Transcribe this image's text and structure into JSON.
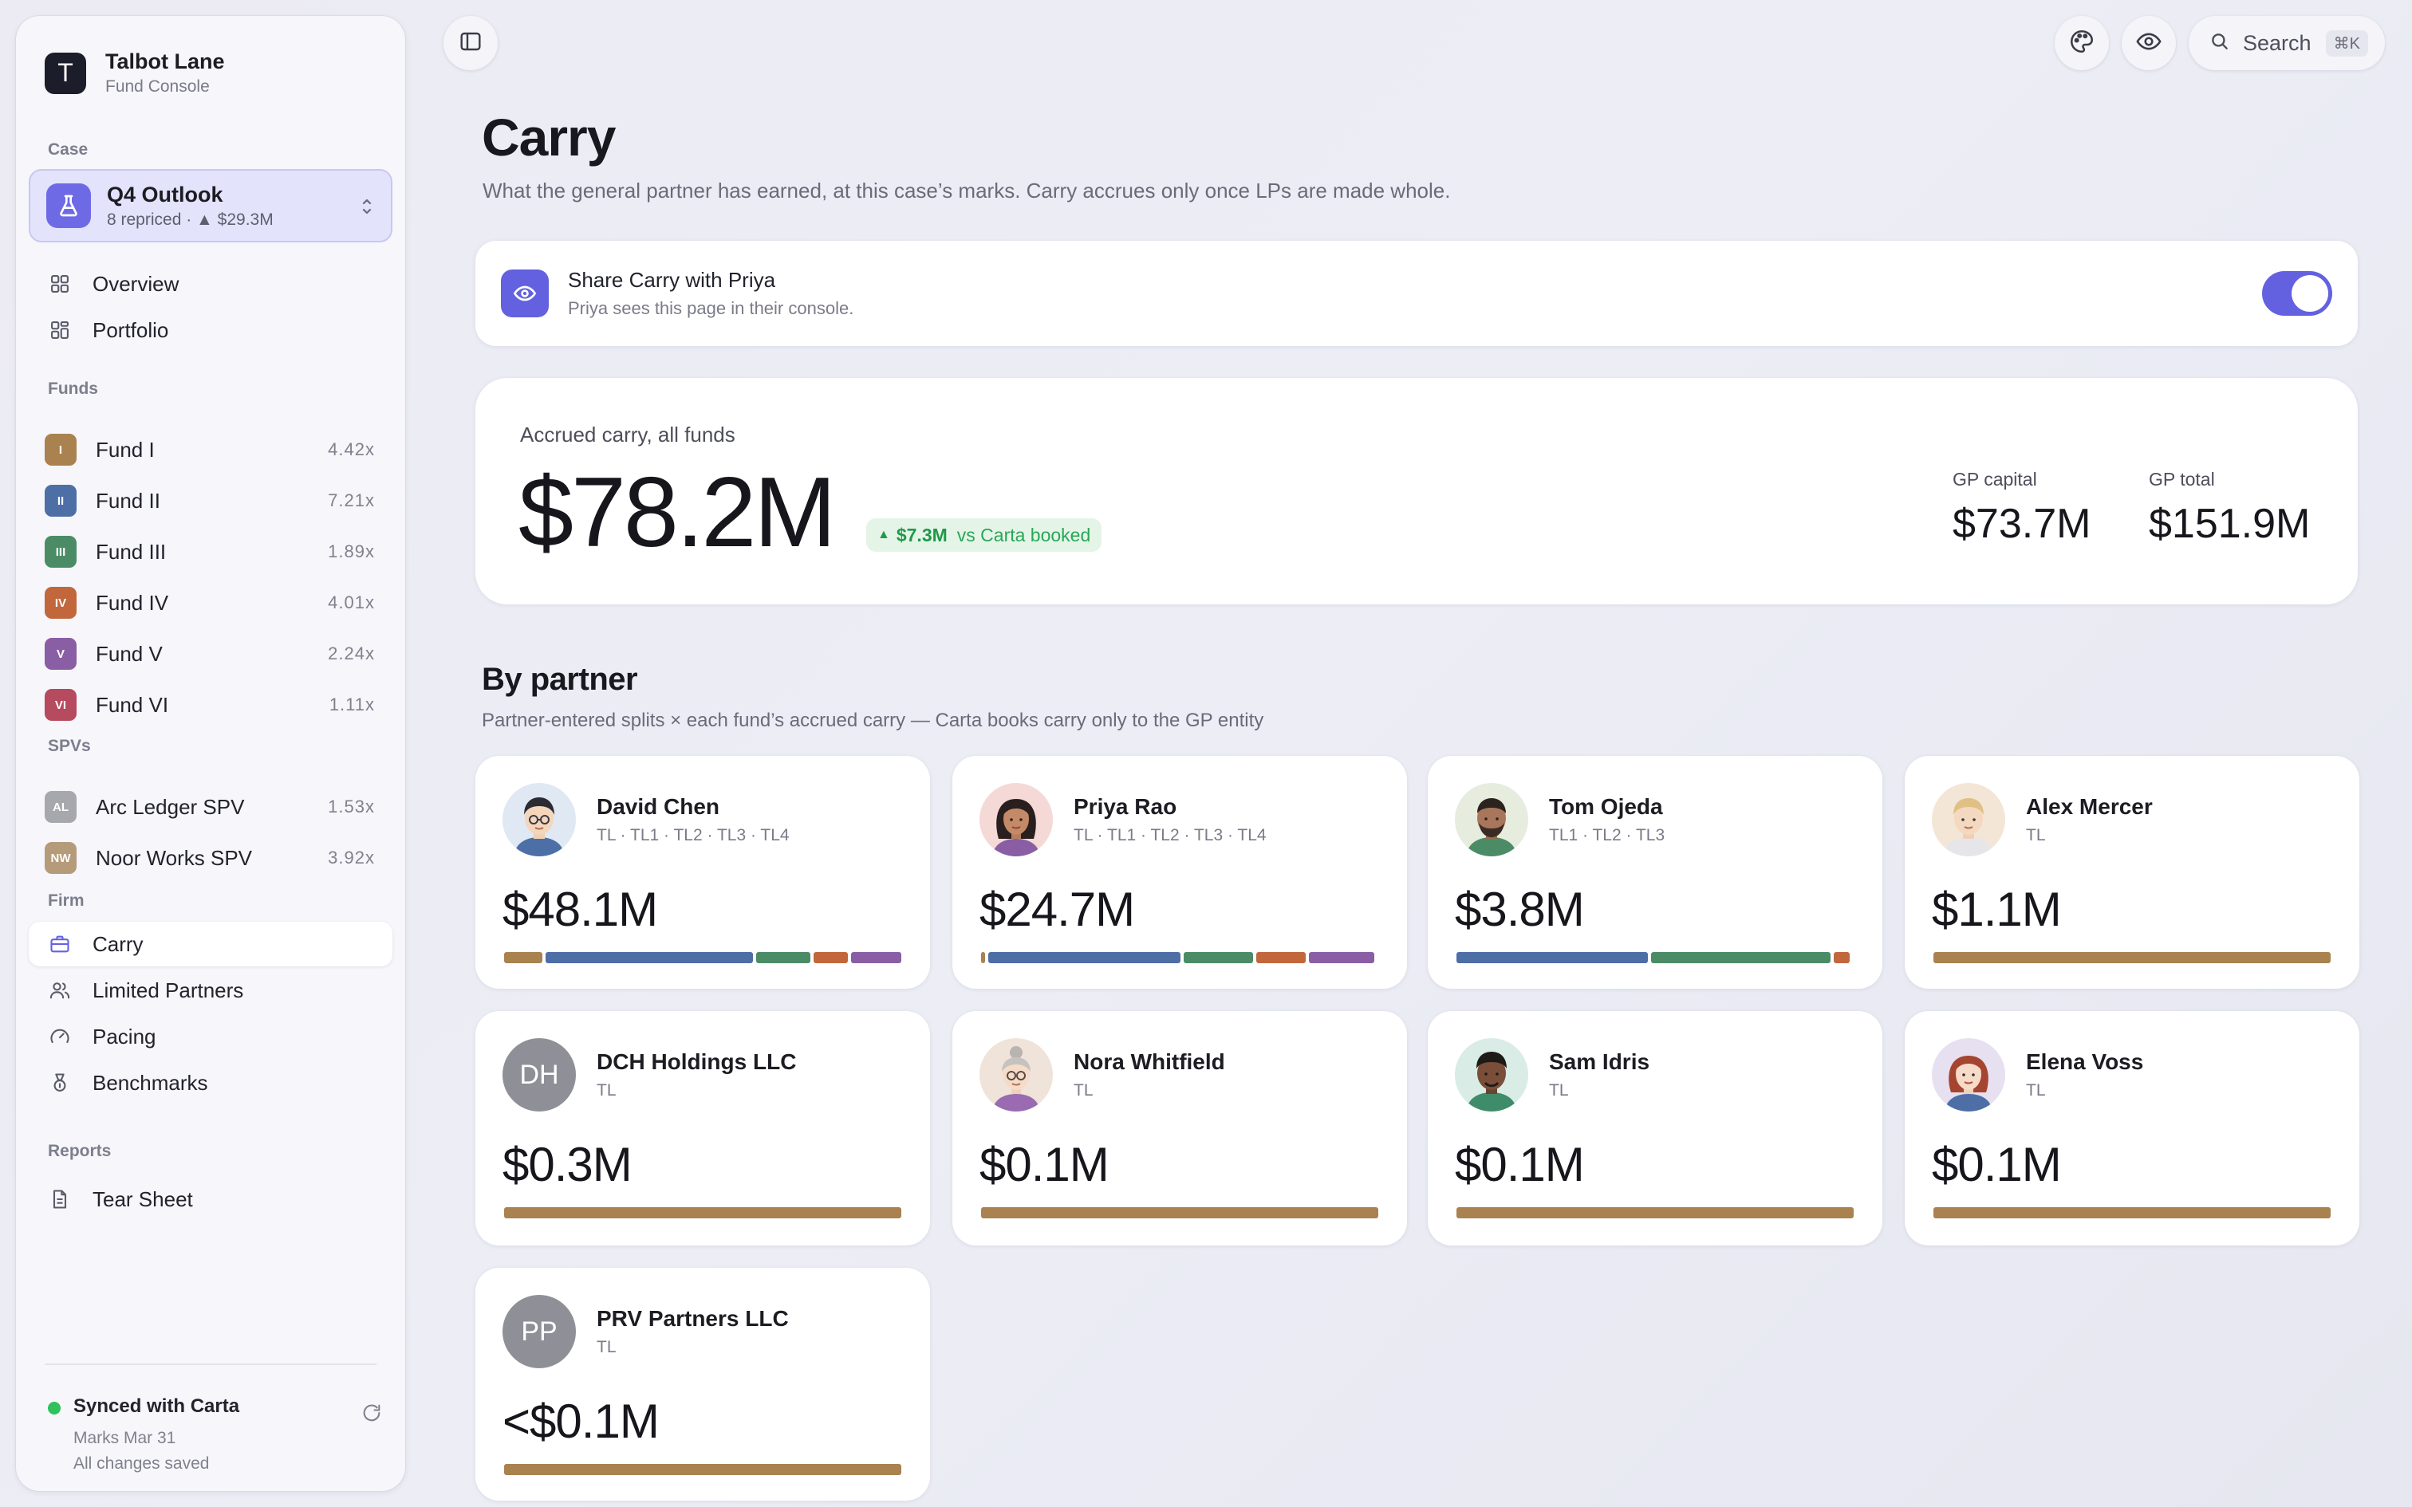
{
  "brand": {
    "initial": "T",
    "name": "Talbot Lane",
    "subtitle": "Fund Console"
  },
  "sidebar": {
    "case_label": "Case",
    "case": {
      "title": "Q4 Outlook",
      "subtitle": "8 repriced · ▲ $29.3M"
    },
    "nav": [
      {
        "label": "Overview",
        "icon": "grid-icon"
      },
      {
        "label": "Portfolio",
        "icon": "portfolio-icon"
      }
    ],
    "funds_label": "Funds",
    "funds": [
      {
        "badge": "I",
        "label": "Fund I",
        "value": "4.42x",
        "color": "#a9824f"
      },
      {
        "badge": "II",
        "label": "Fund II",
        "value": "7.21x",
        "color": "#4e6ea6"
      },
      {
        "badge": "III",
        "label": "Fund III",
        "value": "1.89x",
        "color": "#4b8c67"
      },
      {
        "badge": "IV",
        "label": "Fund IV",
        "value": "4.01x",
        "color": "#c2673c"
      },
      {
        "badge": "V",
        "label": "Fund V",
        "value": "2.24x",
        "color": "#8a5ea4"
      },
      {
        "badge": "VI",
        "label": "Fund VI",
        "value": "1.11x",
        "color": "#b64a5e"
      }
    ],
    "spvs_label": "SPVs",
    "spvs": [
      {
        "badge": "AL",
        "label": "Arc Ledger SPV",
        "value": "1.53x",
        "color": "#a7a7ae"
      },
      {
        "badge": "NW",
        "label": "Noor Works SPV",
        "value": "3.92x",
        "color": "#b69b7b"
      }
    ],
    "firm_label": "Firm",
    "firm": [
      {
        "label": "Carry",
        "icon": "briefcase-icon",
        "active": true
      },
      {
        "label": "Limited Partners",
        "icon": "users-icon"
      },
      {
        "label": "Pacing",
        "icon": "gauge-icon"
      },
      {
        "label": "Benchmarks",
        "icon": "medal-icon"
      }
    ],
    "reports_label": "Reports",
    "reports": [
      {
        "label": "Tear Sheet",
        "icon": "document-icon"
      }
    ],
    "sync": {
      "title": "Synced with Carta",
      "line1": "Marks Mar 31",
      "line2": "All changes saved"
    }
  },
  "topbar": {
    "search_label": "Search",
    "shortcut": "⌘K"
  },
  "page": {
    "title": "Carry",
    "subtitle": "What the general partner has earned, at this case’s marks. Carry accrues only once LPs are made whole."
  },
  "share": {
    "title": "Share Carry with Priya",
    "subtitle": "Priya sees this page in their console.",
    "enabled": true
  },
  "accrued": {
    "label": "Accrued carry, all funds",
    "value": "$78.2M",
    "delta": "$7.3M",
    "delta_suffix": "vs Carta booked",
    "gp_capital_label": "GP capital",
    "gp_capital": "$73.7M",
    "gp_total_label": "GP total",
    "gp_total": "$151.9M"
  },
  "partners_section": {
    "title": "By partner",
    "subtitle": "Partner-entered splits × each fund’s accrued carry — Carta books carry only to the GP entity"
  },
  "fund_colors": {
    "TL": "#a9824f",
    "TL1": "#4e6ea6",
    "TL2": "#4b8c67",
    "TL3": "#c2673c",
    "TL4": "#8a5ea4"
  },
  "partners": [
    {
      "name": "David Chen",
      "tags": "TL · TL1 · TL2 · TL3 · TL4",
      "value": "$48.1M",
      "avatar": "avatar-david-chen",
      "split": [
        {
          "fund": "TL",
          "share": 0.1
        },
        {
          "fund": "TL1",
          "share": 0.54
        },
        {
          "fund": "TL2",
          "share": 0.14
        },
        {
          "fund": "TL3",
          "share": 0.09
        },
        {
          "fund": "TL4",
          "share": 0.13
        }
      ]
    },
    {
      "name": "Priya Rao",
      "tags": "TL · TL1 · TL2 · TL3 · TL4",
      "value": "$24.7M",
      "avatar": "avatar-priya-rao",
      "split": [
        {
          "fund": "TL",
          "share": 0.01
        },
        {
          "fund": "TL1",
          "share": 0.5
        },
        {
          "fund": "TL2",
          "share": 0.18
        },
        {
          "fund": "TL3",
          "share": 0.13
        },
        {
          "fund": "TL4",
          "share": 0.17
        }
      ]
    },
    {
      "name": "Tom Ojeda",
      "tags": "TL1 · TL2 · TL3",
      "value": "$3.8M",
      "avatar": "avatar-tom-ojeda",
      "split": [
        {
          "fund": "TL1",
          "share": 0.49
        },
        {
          "fund": "TL2",
          "share": 0.46
        },
        {
          "fund": "TL3",
          "share": 0.04
        }
      ]
    },
    {
      "name": "Alex Mercer",
      "tags": "TL",
      "value": "$1.1M",
      "avatar": "avatar-alex-mercer",
      "split": [
        {
          "fund": "TL",
          "share": 1
        }
      ]
    },
    {
      "name": "DCH Holdings LLC",
      "tags": "TL",
      "value": "$0.3M",
      "initials": "DH",
      "split": [
        {
          "fund": "TL",
          "share": 1
        }
      ]
    },
    {
      "name": "Nora Whitfield",
      "tags": "TL",
      "value": "$0.1M",
      "avatar": "avatar-nora-whitfield",
      "split": [
        {
          "fund": "TL",
          "share": 1
        }
      ]
    },
    {
      "name": "Sam Idris",
      "tags": "TL",
      "value": "$0.1M",
      "avatar": "avatar-sam-idris",
      "split": [
        {
          "fund": "TL",
          "share": 1
        }
      ]
    },
    {
      "name": "Elena Voss",
      "tags": "TL",
      "value": "$0.1M",
      "avatar": "avatar-elena-voss",
      "split": [
        {
          "fund": "TL",
          "share": 1
        }
      ]
    },
    {
      "name": "PRV Partners LLC",
      "tags": "TL",
      "value": "<$0.1M",
      "initials": "PP",
      "split": [
        {
          "fund": "TL",
          "share": 1
        }
      ]
    }
  ]
}
